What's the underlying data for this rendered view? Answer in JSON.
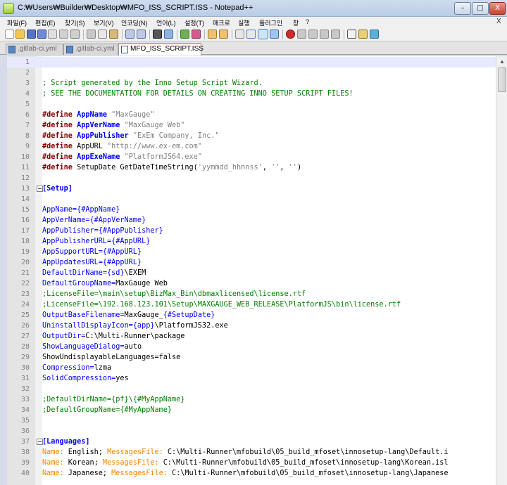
{
  "window": {
    "title": "C:₩Users₩Builder₩Desktop₩MFO_ISS_SCRIPT.ISS - Notepad++",
    "min_glyph": "–",
    "max_glyph": "□",
    "close_glyph": "X"
  },
  "menu": {
    "items": [
      "파일(F)",
      "편집(E)",
      "찾기(S)",
      "보기(V)",
      "인코딩(N)",
      "언어(L)",
      "설정(T)",
      "매크로",
      "실행",
      "플러그인",
      "창",
      "?"
    ],
    "close_glyph": "X"
  },
  "tabs": [
    {
      "label": ".gitlab-ci.yml",
      "active": false
    },
    {
      "label": ".gitlab-ci.yml",
      "active": false
    },
    {
      "label": "MFO_ISS_SCRIPT.ISS",
      "active": true
    }
  ],
  "editor": {
    "current_line": 1,
    "fold_lines": [
      13,
      37
    ],
    "lines": [
      [
        {
          "t": "",
          "c": ""
        }
      ],
      [
        {
          "t": "",
          "c": ""
        }
      ],
      [
        {
          "t": "; Script generated by the Inno Setup Script Wizard.",
          "c": "comment"
        }
      ],
      [
        {
          "t": "; SEE THE DOCUMENTATION FOR DETAILS ON CREATING INNO SETUP SCRIPT FILES!",
          "c": "comment"
        }
      ],
      [
        {
          "t": "",
          "c": ""
        }
      ],
      [
        {
          "t": "#define",
          "c": "define"
        },
        {
          "t": " ",
          "c": ""
        },
        {
          "t": "AppName",
          "c": "const"
        },
        {
          "t": " ",
          "c": ""
        },
        {
          "t": "\"MaxGauge\"",
          "c": "str"
        }
      ],
      [
        {
          "t": "#define",
          "c": "define"
        },
        {
          "t": " ",
          "c": ""
        },
        {
          "t": "AppVerName",
          "c": "const"
        },
        {
          "t": " ",
          "c": ""
        },
        {
          "t": "\"MaxGauge Web\"",
          "c": "str"
        }
      ],
      [
        {
          "t": "#define",
          "c": "define"
        },
        {
          "t": " ",
          "c": ""
        },
        {
          "t": "AppPublisher",
          "c": "const"
        },
        {
          "t": " ",
          "c": ""
        },
        {
          "t": "\"ExEm Company, Inc.\"",
          "c": "str"
        }
      ],
      [
        {
          "t": "#define",
          "c": "define"
        },
        {
          "t": " AppURL ",
          "c": ""
        },
        {
          "t": "\"http://www.ex-em.com\"",
          "c": "str"
        }
      ],
      [
        {
          "t": "#define",
          "c": "define"
        },
        {
          "t": " ",
          "c": ""
        },
        {
          "t": "AppExeName",
          "c": "const"
        },
        {
          "t": " ",
          "c": ""
        },
        {
          "t": "\"PlatformJS64.exe\"",
          "c": "str"
        }
      ],
      [
        {
          "t": "#define",
          "c": "define"
        },
        {
          "t": " SetupDate GetDateTimeString(",
          "c": ""
        },
        {
          "t": "'yymmdd_hhnnss'",
          "c": "str"
        },
        {
          "t": ", ",
          "c": ""
        },
        {
          "t": "''",
          "c": "str"
        },
        {
          "t": ", ",
          "c": ""
        },
        {
          "t": "''",
          "c": "str"
        },
        {
          "t": ")",
          "c": ""
        }
      ],
      [
        {
          "t": "",
          "c": ""
        }
      ],
      [
        {
          "t": "[Setup]",
          "c": "section"
        }
      ],
      [
        {
          "t": "",
          "c": ""
        }
      ],
      [
        {
          "t": "AppName={#AppName}",
          "c": "key"
        }
      ],
      [
        {
          "t": "AppVerName={#AppVerName}",
          "c": "key"
        }
      ],
      [
        {
          "t": "AppPublisher={#AppPublisher}",
          "c": "key"
        }
      ],
      [
        {
          "t": "AppPublisherURL={#AppURL}",
          "c": "key"
        }
      ],
      [
        {
          "t": "AppSupportURL={#AppURL}",
          "c": "key"
        }
      ],
      [
        {
          "t": "AppUpdatesURL={#AppURL}",
          "c": "key"
        }
      ],
      [
        {
          "t": "DefaultDirName={sd}",
          "c": "key"
        },
        {
          "t": "\\EXEM",
          "c": ""
        }
      ],
      [
        {
          "t": "DefaultGroupName=",
          "c": "key"
        },
        {
          "t": "MaxGauge Web",
          "c": ""
        }
      ],
      [
        {
          "t": ";LicenseFile=\\main\\setup\\BizMax_Bin\\dbmaxlicensed\\license.rtf",
          "c": "comment"
        }
      ],
      [
        {
          "t": ";LicenseFile=\\192.168.123.101\\Setup\\MAXGAUGE_WEB_RELEASE\\PlatformJS\\bin\\license.rtf",
          "c": "comment"
        }
      ],
      [
        {
          "t": "OutputBaseFilename=",
          "c": "key"
        },
        {
          "t": "MaxGauge_",
          "c": ""
        },
        {
          "t": "{#SetupDate}",
          "c": "key"
        }
      ],
      [
        {
          "t": "UninstallDisplayIcon={app}",
          "c": "key"
        },
        {
          "t": "\\PlatformJS32.exe",
          "c": ""
        }
      ],
      [
        {
          "t": "OutputDir=",
          "c": "key"
        },
        {
          "t": "C:\\Multi-Runner\\package",
          "c": ""
        }
      ],
      [
        {
          "t": "ShowLanguageDialog=",
          "c": "key"
        },
        {
          "t": "auto",
          "c": ""
        }
      ],
      [
        {
          "t": "ShowUndisplayableLanguages=false",
          "c": ""
        }
      ],
      [
        {
          "t": "Compression=",
          "c": "key"
        },
        {
          "t": "lzma",
          "c": ""
        }
      ],
      [
        {
          "t": "SolidCompression=",
          "c": "key"
        },
        {
          "t": "yes",
          "c": ""
        }
      ],
      [
        {
          "t": "",
          "c": ""
        }
      ],
      [
        {
          "t": ";DefaultDirName={pf}\\{#MyAppName}",
          "c": "comment"
        }
      ],
      [
        {
          "t": ";DefaultGroupName={#MyAppName}",
          "c": "comment"
        }
      ],
      [
        {
          "t": "",
          "c": ""
        }
      ],
      [
        {
          "t": "",
          "c": ""
        }
      ],
      [
        {
          "t": "[Languages]",
          "c": "section"
        }
      ],
      [
        {
          "t": "Name:",
          "c": "pkey"
        },
        {
          "t": " English; ",
          "c": ""
        },
        {
          "t": "MessagesFile:",
          "c": "pkey"
        },
        {
          "t": " C:\\Multi-Runner\\mfobuild\\05_build_mfoset\\innosetup-lang\\Default.i",
          "c": ""
        }
      ],
      [
        {
          "t": "Name:",
          "c": "pkey"
        },
        {
          "t": " Korean; ",
          "c": ""
        },
        {
          "t": "MessagesFile:",
          "c": "pkey"
        },
        {
          "t": " C:\\Multi-Runner\\mfobuild\\05_build_mfoset\\innosetup-lang\\Korean.isl",
          "c": ""
        }
      ],
      [
        {
          "t": "Name:",
          "c": "pkey"
        },
        {
          "t": " Japanese; ",
          "c": ""
        },
        {
          "t": "MessagesFile:",
          "c": "pkey"
        },
        {
          "t": " C:\\Multi-Runner\\mfobuild\\05_build_mfoset\\innosetup-lang\\Japanese",
          "c": ""
        }
      ]
    ]
  },
  "colors": {
    "comment": "#008000",
    "define": "#800000",
    "constant": "#0000ff",
    "string": "#808080",
    "param_key": "#ff8000",
    "active_tab_accent": "#f9a43b"
  },
  "icons": [
    "app-icon",
    "new-file-icon",
    "open-icon",
    "save-icon",
    "save-all-icon",
    "close-icon",
    "close-all-icon",
    "print-icon",
    "cut-icon",
    "copy-icon",
    "paste-icon",
    "undo-icon",
    "redo-icon",
    "find-icon",
    "replace-icon",
    "zoom-in-icon",
    "zoom-out-icon",
    "sync-v-icon",
    "sync-h-icon",
    "word-wrap-icon",
    "show-all-chars-icon",
    "indent-guide-icon",
    "doc-map-icon",
    "record-macro-icon",
    "stop-macro-icon",
    "play-macro-icon",
    "run-macro-multiple-icon",
    "save-macro-icon",
    "html-tag-icon",
    "spell-check-icon",
    "check-icon"
  ]
}
